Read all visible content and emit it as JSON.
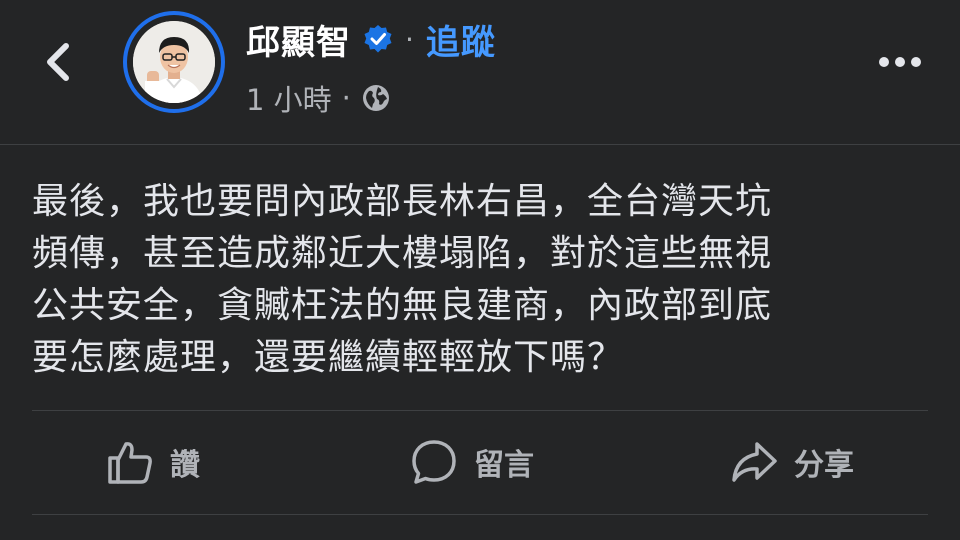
{
  "post": {
    "author_name": "邱顯智",
    "follow_label": "追蹤",
    "separator": "·",
    "timestamp": "1 小時",
    "meta_separator": "·",
    "text": "最後，我也要問內政部長林右昌，全台灣天坑\n頻傳，甚至造成鄰近大樓塌陷，對於這些無視\n公共安全，貪贓枉法的無良建商，內政部到底\n要怎麼處理，還要繼續輕輕放下嗎？"
  },
  "actions": {
    "like_label": "讚",
    "comment_label": "留言",
    "share_label": "分享"
  },
  "icons": {
    "back": "chevron-left-icon",
    "verified": "verified-badge-icon",
    "globe": "globe-icon",
    "more": "more-dots-icon",
    "like": "thumbs-up-icon",
    "comment": "comment-bubble-icon",
    "share": "share-arrow-icon"
  },
  "colors": {
    "background": "#242526",
    "link_blue": "#4599ff",
    "avatar_ring": "#1f6feb",
    "text_primary": "#e4e6eb",
    "text_secondary": "#b0b3b8"
  }
}
